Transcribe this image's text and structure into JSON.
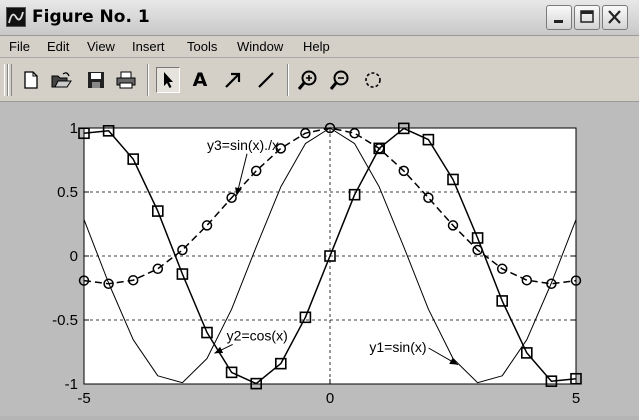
{
  "window": {
    "title": "Figure No. 1",
    "controls": [
      "minimize-icon",
      "maximize-icon",
      "close-icon"
    ]
  },
  "menu": {
    "items": [
      "File",
      "Edit",
      "View",
      "Insert",
      "Tools",
      "Window",
      "Help"
    ]
  },
  "toolbar": {
    "tools": [
      {
        "name": "new-figure-icon"
      },
      {
        "name": "open-file-icon"
      },
      {
        "name": "save-icon"
      },
      {
        "name": "print-icon"
      },
      {
        "name": "edit-plot-arrow-icon",
        "pressed": true
      },
      {
        "name": "insert-text-icon",
        "glyph": "A"
      },
      {
        "name": "insert-arrow-icon"
      },
      {
        "name": "insert-line-icon"
      },
      {
        "name": "zoom-in-icon"
      },
      {
        "name": "zoom-out-icon"
      },
      {
        "name": "rotate-3d-icon"
      }
    ]
  },
  "colors": {
    "window_bg": "#d4d0c8",
    "figure_bg": "#bcbcbc",
    "axes_bg": "#ffffff",
    "line": "#000000"
  },
  "chart_data": {
    "type": "line",
    "xlim": [
      -5,
      5
    ],
    "ylim": [
      -1,
      1
    ],
    "xticks": [
      "-5",
      "0",
      "5"
    ],
    "yticks": [
      "1",
      "0.5",
      "0",
      "-0.5",
      "-1"
    ],
    "grid": true,
    "x": [
      -5,
      -4.5,
      -4,
      -3.5,
      -3,
      -2.5,
      -2,
      -1.5,
      -1,
      -0.5,
      0,
      0.5,
      1,
      1.5,
      2,
      2.5,
      3,
      3.5,
      4,
      4.5,
      5
    ],
    "series": [
      {
        "expr": "sin(x)",
        "style": "solid-square-markers",
        "width": 1.5,
        "values": [
          0.959,
          0.978,
          0.757,
          0.351,
          -0.141,
          -0.598,
          -0.909,
          -0.997,
          -0.841,
          -0.479,
          0,
          0.479,
          0.841,
          0.997,
          0.909,
          0.598,
          0.141,
          -0.351,
          -0.757,
          -0.978,
          -0.959
        ]
      },
      {
        "expr": "cos(x)",
        "style": "thin-solid",
        "width": 1,
        "values": [
          0.284,
          -0.211,
          -0.654,
          -0.936,
          -0.99,
          -0.801,
          -0.416,
          0.071,
          0.54,
          0.878,
          1,
          0.878,
          0.54,
          0.071,
          -0.416,
          -0.801,
          -0.99,
          -0.936,
          -0.654,
          -0.211,
          0.284
        ]
      },
      {
        "expr": "sin(x)./x",
        "style": "dashed-circle-markers",
        "width": 1.5,
        "values": [
          -0.192,
          -0.217,
          -0.189,
          -0.1,
          0.047,
          0.239,
          0.455,
          0.665,
          0.841,
          0.959,
          1,
          0.959,
          0.841,
          0.665,
          0.455,
          0.239,
          0.047,
          -0.1,
          -0.189,
          -0.217,
          -0.192
        ]
      }
    ],
    "annotations": [
      {
        "text": "y3=sin(x)./x",
        "at": [
          -2.5,
          0.83
        ],
        "arrow_to": [
          -1.9,
          0.47
        ]
      },
      {
        "text": "y2=cos(x)",
        "at": [
          -2.1,
          -0.66
        ],
        "arrow_to": [
          -2.35,
          -0.76
        ]
      },
      {
        "text": "y1=sin(x)",
        "at": [
          0.8,
          -0.75
        ],
        "arrow_to": [
          2.6,
          -0.85
        ]
      }
    ]
  }
}
